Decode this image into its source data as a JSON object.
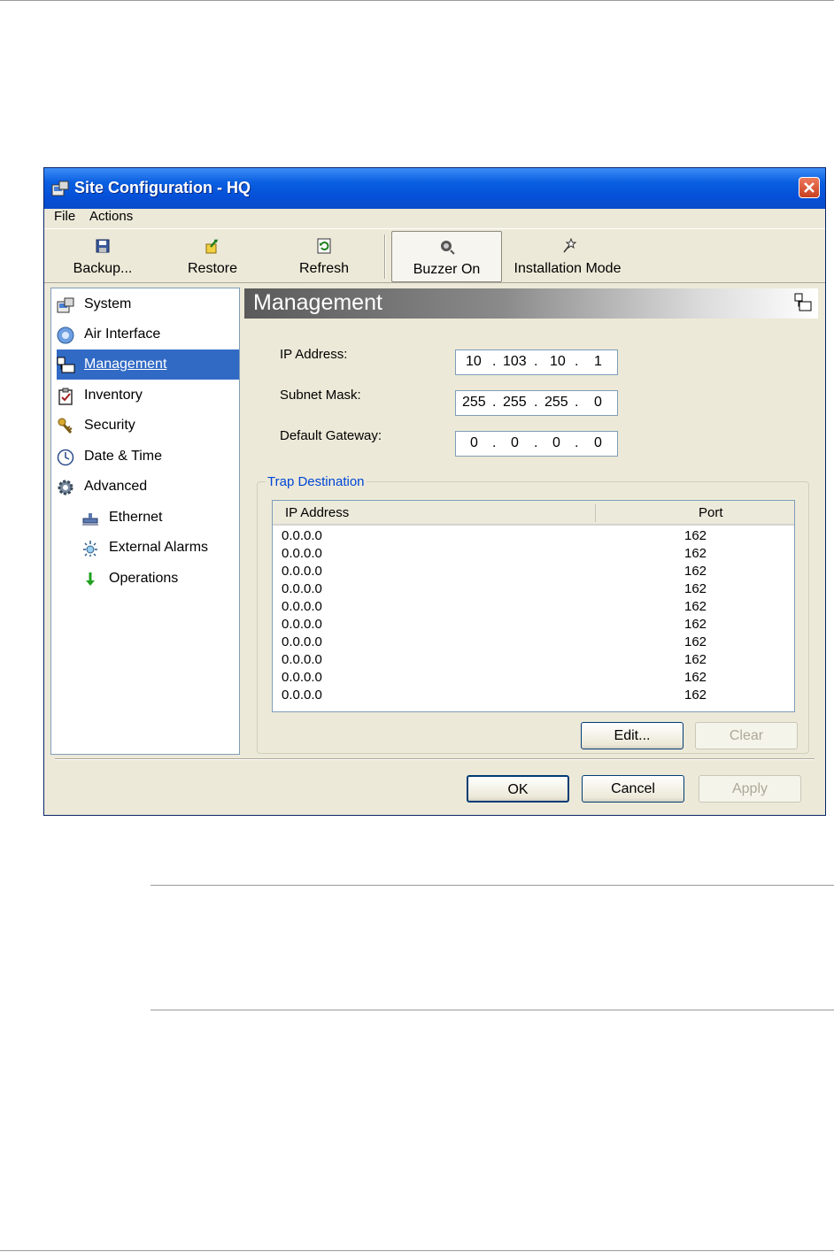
{
  "window": {
    "title": "Site Configuration - HQ",
    "menu": [
      "File",
      "Actions"
    ],
    "toolbar": [
      {
        "label": "Backup...",
        "icon": "floppy-disk-icon"
      },
      {
        "label": "Restore",
        "icon": "restore-arrow-icon"
      },
      {
        "label": "Refresh",
        "icon": "refresh-icon"
      },
      {
        "label": "Buzzer On",
        "icon": "buzzer-icon",
        "pressed": true
      },
      {
        "label": "Installation Mode",
        "icon": "installation-wand-icon"
      }
    ]
  },
  "nav": {
    "items": [
      {
        "label": "System",
        "icon": "system-icon"
      },
      {
        "label": "Air Interface",
        "icon": "air-interface-icon"
      },
      {
        "label": "Management",
        "icon": "management-icon",
        "selected": true
      },
      {
        "label": "Inventory",
        "icon": "inventory-clipboard-icon"
      },
      {
        "label": "Security",
        "icon": "security-keys-icon"
      },
      {
        "label": "Date & Time",
        "icon": "clock-icon"
      },
      {
        "label": "Advanced",
        "icon": "gear-icon"
      },
      {
        "label": "Ethernet",
        "icon": "ethernet-icon"
      },
      {
        "label": "External Alarms",
        "icon": "alarm-icon"
      },
      {
        "label": "Operations",
        "icon": "operations-arrow-icon"
      }
    ]
  },
  "content": {
    "title": "Management",
    "fields": [
      {
        "label": "IP Address:",
        "octets": [
          "10",
          "103",
          "10",
          "1"
        ]
      },
      {
        "label": "Subnet Mask:",
        "octets": [
          "255",
          "255",
          "255",
          "0"
        ]
      },
      {
        "label": "Default Gateway:",
        "octets": [
          "0",
          "0",
          "0",
          "0"
        ]
      }
    ],
    "trap": {
      "title": "Trap Destination",
      "columns": [
        "IP Address",
        "Port"
      ],
      "rows": [
        [
          "0.0.0.0",
          "162"
        ],
        [
          "0.0.0.0",
          "162"
        ],
        [
          "0.0.0.0",
          "162"
        ],
        [
          "0.0.0.0",
          "162"
        ],
        [
          "0.0.0.0",
          "162"
        ],
        [
          "0.0.0.0",
          "162"
        ],
        [
          "0.0.0.0",
          "162"
        ],
        [
          "0.0.0.0",
          "162"
        ],
        [
          "0.0.0.0",
          "162"
        ],
        [
          "0.0.0.0",
          "162"
        ]
      ],
      "edit_label": "Edit...",
      "clear_label": "Clear"
    }
  },
  "footer": {
    "ok_label": "OK",
    "cancel_label": "Cancel",
    "apply_label": "Apply"
  },
  "colors": {
    "titlebar": "#0550d8",
    "selection": "#316ac5",
    "dialog_bg": "#ece9d8",
    "group_title": "#0046d5"
  }
}
